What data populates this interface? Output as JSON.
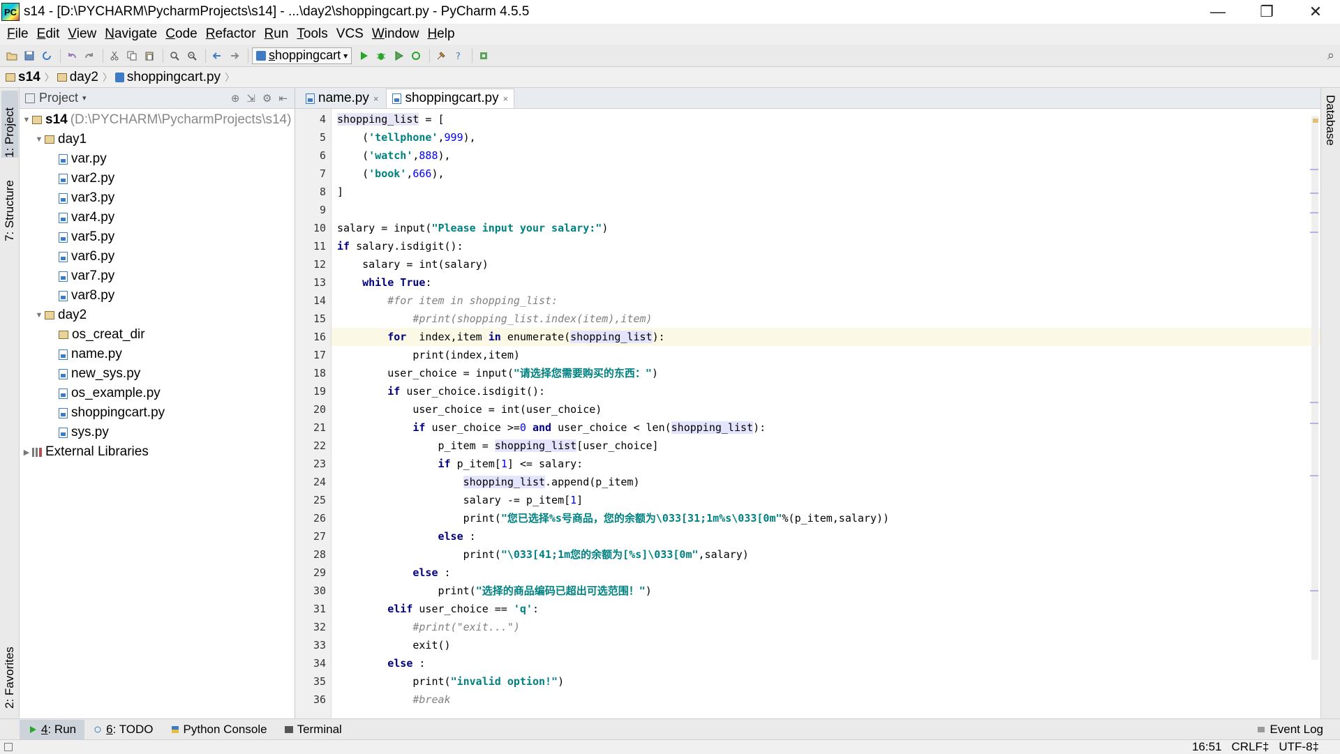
{
  "window": {
    "title": "s14 - [D:\\PYCHARM\\PycharmProjects\\s14] - ...\\day2\\shoppingcart.py - PyCharm 4.5.5",
    "icon": "PC",
    "minimize": "—",
    "restore": "❐",
    "close": "✕"
  },
  "menu": [
    {
      "u": "F",
      "rest": "ile"
    },
    {
      "u": "E",
      "rest": "dit"
    },
    {
      "u": "V",
      "rest": "iew"
    },
    {
      "u": "N",
      "rest": "avigate"
    },
    {
      "u": "C",
      "rest": "ode"
    },
    {
      "u": "R",
      "rest": "efactor"
    },
    {
      "u": "R",
      "rest": "un"
    },
    {
      "u": "T",
      "rest": "ools"
    },
    {
      "u": "",
      "rest": "VCS"
    },
    {
      "u": "W",
      "rest": "indow"
    },
    {
      "u": "H",
      "rest": "elp"
    }
  ],
  "toolbar": {
    "run_config_u": "s",
    "run_config_rest": "hoppingcart",
    "dropdown": "▾",
    "search_icon": "⌕"
  },
  "breadcrumb": {
    "root": "s14",
    "folder": "day2",
    "file": "shoppingcart.py"
  },
  "side_tabs": {
    "project": "1: Project",
    "structure": "7: Structure",
    "favorites": "2: Favorites",
    "database": "Database"
  },
  "project_panel": {
    "header": "Project",
    "root_name": "s14",
    "root_path": "(D:\\PYCHARM\\PycharmProjects\\s14)",
    "day1": "day1",
    "day1_files": [
      "var.py",
      "var2.py",
      "var3.py",
      "var4.py",
      "var5.py",
      "var6.py",
      "var7.py",
      "var8.py"
    ],
    "day2": "day2",
    "day2_dir": "os_creat_dir",
    "day2_files": [
      "name.py",
      "new_sys.py",
      "os_example.py",
      "shoppingcart.py",
      "sys.py"
    ],
    "external": "External Libraries"
  },
  "editor_tabs": {
    "tab1": "name.py",
    "tab2": "shoppingcart.py",
    "close": "×"
  },
  "line_numbers": [
    "4",
    "5",
    "6",
    "7",
    "8",
    "9",
    "10",
    "11",
    "12",
    "13",
    "14",
    "15",
    "16",
    "17",
    "18",
    "19",
    "20",
    "21",
    "22",
    "23",
    "24",
    "25",
    "26",
    "27",
    "28",
    "29",
    "30",
    "31",
    "32",
    "33",
    "34",
    "35",
    "36"
  ],
  "code": {
    "l4_a": "shopping_list",
    "l4_b": " = [",
    "l5_a": "    (",
    "l5_b": "'tellphone'",
    "l5_c": ",",
    "l5_d": "999",
    "l5_e": "),",
    "l6_a": "    (",
    "l6_b": "'watch'",
    "l6_c": ",",
    "l6_d": "888",
    "l6_e": "),",
    "l7_a": "    (",
    "l7_b": "'book'",
    "l7_c": ",",
    "l7_d": "666",
    "l7_e": "),",
    "l8": "]",
    "l10_a": "salary = input(",
    "l10_b": "\"Please input your salary:\"",
    "l10_c": ")",
    "l11_a": "if",
    "l11_b": " salary.isdigit():",
    "l12_a": "    salary = ",
    "l12_b": "int",
    "l12_c": "(salary)",
    "l13_a": "    ",
    "l13_b": "while True",
    "l13_c": ":",
    "l14": "        #for item in shopping_list:",
    "l15": "            #print(shopping_list.index(item),item)",
    "l16_a": "        ",
    "l16_b": "for",
    "l16_c": "  index,item ",
    "l16_d": "in",
    "l16_e": " enumerate(",
    "l16_f": "shopping_list",
    "l16_g": "):",
    "l17": "            print(index,item)",
    "l18_a": "        user_choice = input(",
    "l18_b": "\"请选择您需要购买的东西：\"",
    "l18_c": ")",
    "l19_a": "        ",
    "l19_b": "if",
    "l19_c": " user_choice.isdigit():",
    "l20_a": "            user_choice = ",
    "l20_b": "int",
    "l20_c": "(user_choice)",
    "l21_a": "            ",
    "l21_b": "if",
    "l21_c": " user_choice >=",
    "l21_d": "0",
    "l21_e": " ",
    "l21_f": "and",
    "l21_g": " user_choice < len(",
    "l21_h": "shopping_list",
    "l21_i": "):",
    "l22_a": "                p_item = ",
    "l22_b": "shopping_list",
    "l22_c": "[user_choice]",
    "l23_a": "                ",
    "l23_b": "if",
    "l23_c": " p_item[",
    "l23_d": "1",
    "l23_e": "] <= salary:",
    "l24_a": "                    ",
    "l24_b": "shopping_list",
    "l24_c": ".append(p_item)",
    "l25_a": "                    salary -= p_item[",
    "l25_b": "1",
    "l25_c": "]",
    "l26_a": "                    print(",
    "l26_b": "\"您已选择%s号商品，您的余额为\\033[31;1m%s\\033[0m\"",
    "l26_c": "%(p_item,salary))",
    "l27_a": "                ",
    "l27_b": "else",
    "l27_c": " :",
    "l28_a": "                    print(",
    "l28_b": "\"\\033[41;1m您的余额为[%s]\\033[0m\"",
    "l28_c": ",salary)",
    "l29_a": "            ",
    "l29_b": "else",
    "l29_c": " :",
    "l30_a": "                print(",
    "l30_b": "\"选择的商品编码已超出可选范围！\"",
    "l30_c": ")",
    "l31_a": "        ",
    "l31_b": "elif",
    "l31_c": " user_choice == ",
    "l31_d": "'q'",
    "l31_e": ":",
    "l32": "            #print(\"exit...\")",
    "l33": "            exit()",
    "l34_a": "        ",
    "l34_b": "else",
    "l34_c": " :",
    "l35_a": "            print(",
    "l35_b": "\"invalid option!\"",
    "l35_c": ")",
    "l36": "            #break"
  },
  "bottom_tabs": {
    "run_u": "4",
    "run_rest": ": Run",
    "todo_u": "6",
    "todo_rest": ": TODO",
    "console": "Python Console",
    "terminal": "Terminal",
    "event_log": "Event Log"
  },
  "status": {
    "position": "16:51",
    "line_sep": "CRLF‡",
    "encoding": "UTF-8‡"
  },
  "colors": {
    "keyword": "#000080",
    "string": "#008080",
    "number": "#0000ff",
    "comment": "#808080"
  }
}
